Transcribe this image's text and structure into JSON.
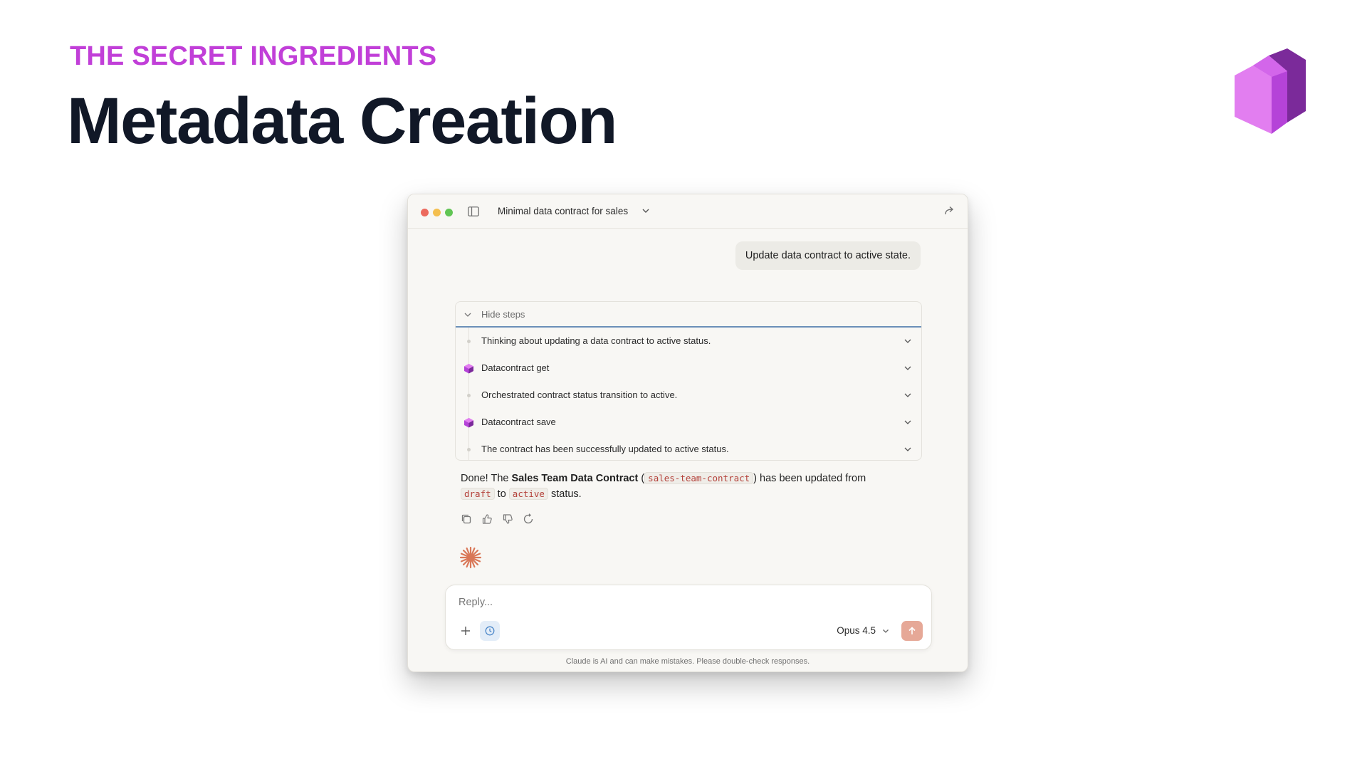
{
  "slide": {
    "eyebrow": "THE SECRET INGREDIENTS",
    "title": "Metadata Creation"
  },
  "colors": {
    "eyebrow": "#c13fd8",
    "title": "#111827",
    "logo_light": "#e27ef0",
    "logo_mid": "#b543d8",
    "logo_dark": "#7b2a9a",
    "accent_line": "#6b8fb8",
    "send_button": "#e6a897",
    "spark": "#d97757"
  },
  "window": {
    "conversation_title": "Minimal data contract for sales",
    "user_message": "Update data contract to active state."
  },
  "steps": {
    "header_label": "Hide steps",
    "items": [
      {
        "type": "thought",
        "label": "Thinking about updating a data contract to active status."
      },
      {
        "type": "tool",
        "label": "Datacontract get"
      },
      {
        "type": "thought",
        "label": "Orchestrated contract status transition to active."
      },
      {
        "type": "tool",
        "label": "Datacontract save"
      },
      {
        "type": "thought",
        "label": "The contract has been successfully updated to active status."
      }
    ]
  },
  "answer": {
    "prefix": "Done! The ",
    "contract_name": "Sales Team Data Contract",
    "open_paren": " (",
    "contract_id": "sales-team-contract",
    "close_paren": ")",
    "middle": " has been updated from ",
    "from_status": "draft",
    "to_word": " to ",
    "to_status": "active",
    "suffix": " status."
  },
  "message_actions": [
    "copy-icon",
    "thumbs-up-icon",
    "thumbs-down-icon",
    "retry-icon"
  ],
  "composer": {
    "placeholder": "Reply...",
    "model": "Opus 4.5"
  },
  "disclaimer": "Claude is AI and can make mistakes. Please double-check responses."
}
